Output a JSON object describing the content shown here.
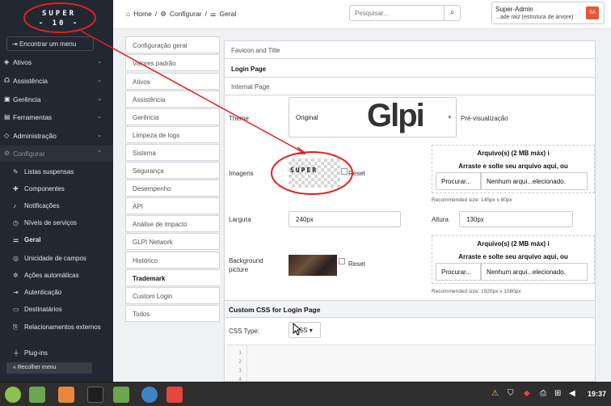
{
  "sidebar": {
    "logo_line1": "SUPER",
    "logo_line2": "- 10 -",
    "find_menu": "Encontrar um menu",
    "nav": [
      {
        "label": "Ativos",
        "icon": "box-icon"
      },
      {
        "label": "Assistência",
        "icon": "headset-icon"
      },
      {
        "label": "Gerência",
        "icon": "wallet-icon"
      },
      {
        "label": "Ferramentas",
        "icon": "briefcase-icon"
      },
      {
        "label": "Administração",
        "icon": "shield-icon"
      },
      {
        "label": "Configurar",
        "icon": "gear-icon"
      }
    ],
    "sub_items": [
      {
        "label": "Listas suspensas",
        "icon": "edit-icon"
      },
      {
        "label": "Componentes",
        "icon": "puzzle-icon"
      },
      {
        "label": "Notificações",
        "icon": "bell-icon"
      },
      {
        "label": "Níveis de serviços",
        "icon": "clock-icon"
      },
      {
        "label": "Geral",
        "icon": "sliders-icon"
      },
      {
        "label": "Unicidade de campos",
        "icon": "fingerprint-icon"
      },
      {
        "label": "Ações automáticas",
        "icon": "cog-icon"
      },
      {
        "label": "Autenticação",
        "icon": "login-icon"
      },
      {
        "label": "Destinatários",
        "icon": "inbox-icon"
      },
      {
        "label": "Relacionamentos externos",
        "icon": "link-icon"
      },
      {
        "label": "Plug-ins",
        "icon": "plug-icon"
      }
    ],
    "collapse": "Recolher menu"
  },
  "header": {
    "breadcrumb": [
      "Home",
      "/",
      "Configurar",
      "/",
      "Geral"
    ],
    "search_placeholder": "Pesquisar...",
    "user_name": "Super-Admin",
    "user_entity": "...ade raiz (estrutura de árvore)",
    "avatar": "SA"
  },
  "tabs": [
    "Configuração geral",
    "Valores padrão",
    "Ativos",
    "Assistência",
    "Gerência",
    "Limpeza de logs",
    "Sistema",
    "Segurança",
    "Desempenho",
    "API",
    "Análise de impacto",
    "GLPI Network",
    "Histórico",
    "Trademark",
    "Custom Login",
    "Todos"
  ],
  "active_tab": "Trademark",
  "panel": {
    "accordions": [
      "Favicon and Title",
      "Login Page",
      "Internal Page"
    ],
    "theme_label": "Theme",
    "theme_value": "Original",
    "preview_label": "Pré-visualização",
    "logo_preview": "Glpi",
    "images_label": "Imagens",
    "reset": "Reset",
    "width_label": "Largura",
    "width_value": "240px",
    "height_label": "Altura",
    "height_value": "130px",
    "bg_label": "Background picture",
    "dropzone_title": "Arquivo(s) (2 MB máx)",
    "dropzone_info": "i",
    "dropzone_sub": "Arraste e solte seu arquivo aqui, ou",
    "browse": "Procurar...",
    "no_file": "Nenhum arqui...elecionado.",
    "recommended_1": "Recommended size: 145px x 80px",
    "recommended_2": "Recommended size: 1920px x 1080px",
    "css_section": "Custom CSS for Login Page",
    "css_type_label": "CSS Type:",
    "css_type_value": "CSS",
    "line_numbers": [
      "1",
      "2",
      "3",
      "4"
    ],
    "annotation_color": "#e02020"
  },
  "taskbar": {
    "clock": "19:37"
  }
}
